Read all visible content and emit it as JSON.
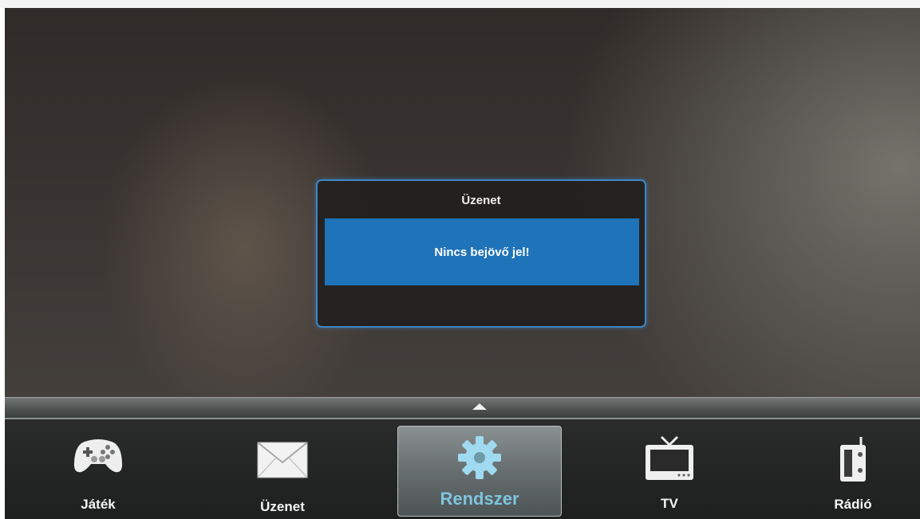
{
  "dialog": {
    "title": "Üzenet",
    "message": "Nincs bejövő jel!"
  },
  "menu": {
    "items": [
      {
        "label": "Játék",
        "icon": "gamepad-icon"
      },
      {
        "label": "Üzenet",
        "icon": "envelope-icon"
      },
      {
        "label": "Rendszer",
        "icon": "gear-icon",
        "active": true
      },
      {
        "label": "TV",
        "icon": "tv-icon"
      },
      {
        "label": "Rádió",
        "icon": "radio-icon"
      }
    ]
  },
  "colors": {
    "accent": "#1f73b8",
    "active_label": "#7fc4de"
  }
}
